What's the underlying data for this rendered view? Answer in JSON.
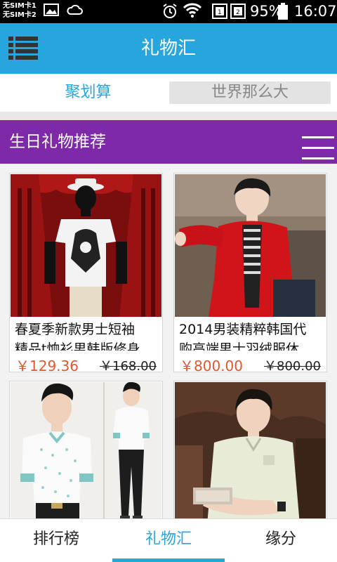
{
  "status_bar": {
    "sim_lines": [
      "无SIM卡1",
      "无SIM卡2"
    ],
    "battery_percent": "95%",
    "time": "16:07"
  },
  "header": {
    "title": "礼物汇",
    "menu_icon": "menu-icon"
  },
  "top_tabs": [
    {
      "label": "聚划算",
      "selected": true
    },
    {
      "label": "世界那么大",
      "selected": false
    }
  ],
  "section": {
    "title": "生日礼物推荐",
    "menu_icon": "list-menu-icon"
  },
  "products": [
    {
      "name": "春夏季新款男士短袖",
      "name_line2": "精品t恤衫男韩版修身",
      "price": "￥129.36",
      "original_price": "￥168.00"
    },
    {
      "name": "2014男装精粹韩国代",
      "name_line2": "购高端男士羽绒服休",
      "price": "￥800.00",
      "original_price": "￥800.00"
    },
    {
      "name": "",
      "name_line2": "",
      "price": "",
      "original_price": ""
    },
    {
      "name": "",
      "name_line2": "",
      "price": "",
      "original_price": ""
    }
  ],
  "bottom_nav": [
    {
      "label": "排行榜",
      "active": false
    },
    {
      "label": "礼物汇",
      "active": true
    },
    {
      "label": "缘分",
      "active": false
    }
  ],
  "colors": {
    "accent": "#27a6dd",
    "section_bar": "#7e2aa8",
    "price": "#e4572e"
  }
}
